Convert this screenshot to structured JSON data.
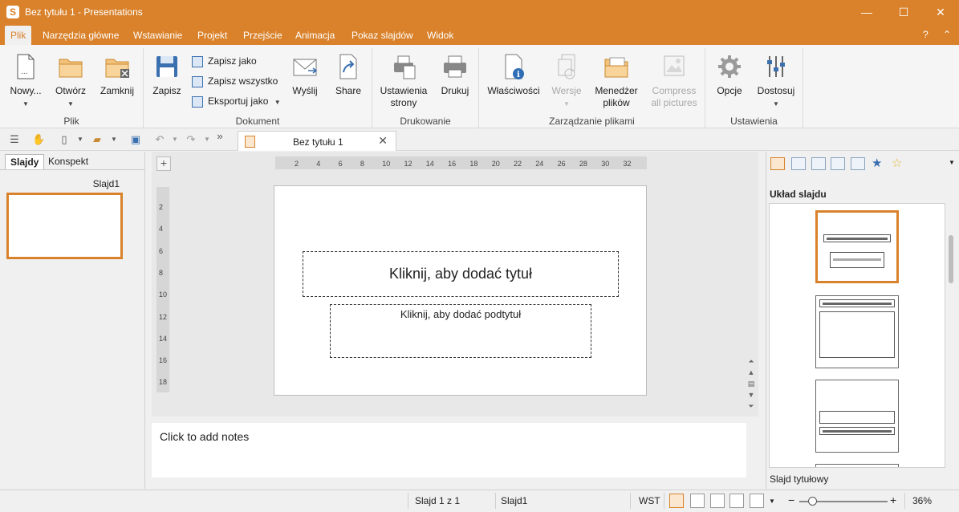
{
  "window": {
    "title": "Bez tytułu 1 - Presentations",
    "app_icon": "S",
    "minimize": "—",
    "maximize": "☐",
    "close": "✕"
  },
  "menu": {
    "tabs": [
      "Plik",
      "Narzędzia główne",
      "Wstawianie",
      "Projekt",
      "Przejście",
      "Animacja",
      "Pokaz slajdów",
      "Widok"
    ],
    "active_tab": "Plik",
    "help": "?",
    "collapse": "⌃"
  },
  "ribbon": {
    "plik": {
      "label": "Plik",
      "new": "Nowy...",
      "open": "Otwórz",
      "close": "Zamknij"
    },
    "dokument": {
      "label": "Dokument",
      "save": "Zapisz",
      "save_as": "Zapisz jako",
      "save_all": "Zapisz wszystko",
      "export_as": "Eksportuj jako",
      "send": "Wyślij",
      "share": "Share"
    },
    "drukowanie": {
      "label": "Drukowanie",
      "page_setup_line1": "Ustawienia",
      "page_setup_line2": "strony",
      "print": "Drukuj"
    },
    "zarzadzanie": {
      "label": "Zarządzanie plikami",
      "properties": "Właściwości",
      "versions": "Wersje",
      "manager_line1": "Menedżer",
      "manager_line2": "plików",
      "compress_line1": "Compress",
      "compress_line2": "all pictures"
    },
    "ustawienia": {
      "label": "Ustawienia",
      "options": "Opcje",
      "customize": "Dostosuj"
    }
  },
  "quickbar": {
    "more": "»",
    "doc_tab": "Bez tytułu 1",
    "doc_tab_close": "✕"
  },
  "left_pane": {
    "tabs": [
      "Slajdy",
      "Konspekt"
    ],
    "active_tab": "Slajdy",
    "slide_label": "Slajd1"
  },
  "ruler": {
    "h_ticks": [
      "2",
      "4",
      "6",
      "8",
      "10",
      "12",
      "14",
      "16",
      "18",
      "20",
      "22",
      "24",
      "26",
      "28",
      "30",
      "32"
    ],
    "v_ticks": [
      "2",
      "4",
      "6",
      "8",
      "10",
      "12",
      "14",
      "16",
      "18"
    ]
  },
  "slide": {
    "title_placeholder": "Kliknij, aby dodać tytuł",
    "subtitle_placeholder": "Kliknij, aby dodać podtytuł"
  },
  "notes": {
    "placeholder": "Click to add notes"
  },
  "right_pane": {
    "heading": "Układ slajdu",
    "footer": "Slajd tytułowy",
    "active_layout_index": 0
  },
  "status": {
    "slide_pos": "Slajd 1 z 1",
    "slide_name": "Slajd1",
    "mode": "WST",
    "zoom_minus": "−",
    "zoom_plus": "+",
    "zoom": "36%",
    "zoom_fraction": 0.1
  },
  "colors": {
    "accent": "#d9822b",
    "accent_light": "#fbe7cf"
  }
}
